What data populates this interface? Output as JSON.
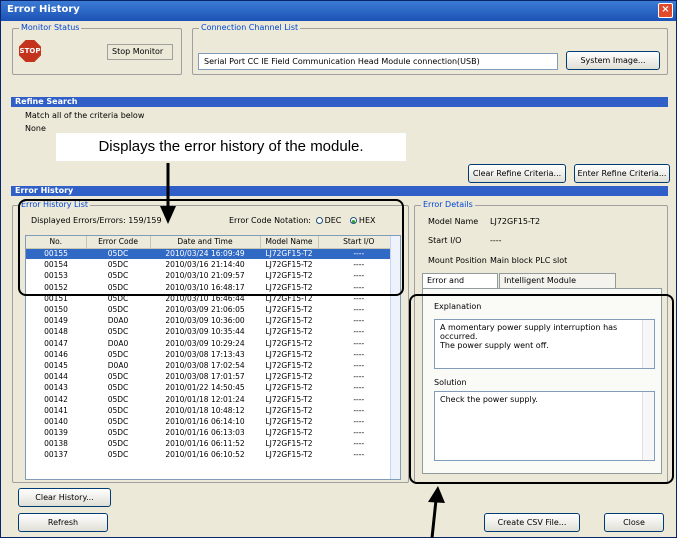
{
  "window": {
    "title": "Error History",
    "close": "×"
  },
  "monitor": {
    "group": "Monitor Status",
    "stop_icon": "STOP",
    "status": "Stop Monitor"
  },
  "connection": {
    "group": "Connection Channel List",
    "value": "Serial Port CC IE Field Communication Head Module connection(USB)",
    "system_image": "System Image..."
  },
  "refine": {
    "header": "Refine Search",
    "criteria": "Match all of the criteria below",
    "none": "None",
    "clear": "Clear Refine Criteria...",
    "enter": "Enter Refine Criteria..."
  },
  "callout": "Displays the error history of the module.",
  "history": {
    "header": "Error History",
    "list_group": "Error History List",
    "displayed": "Displayed Errors/Errors:  159/159",
    "notation_label": "Error Code Notation:",
    "dec": "DEC",
    "hex": "HEX",
    "columns": [
      "No.",
      "Error Code",
      "Date and Time",
      "Model Name",
      "Start I/O"
    ],
    "rows": [
      [
        "00155",
        "05DC",
        "2010/03/24 16:09:49",
        "LJ72GF15-T2",
        "----"
      ],
      [
        "00154",
        "05DC",
        "2010/03/16 21:14:40",
        "LJ72GF15-T2",
        "----"
      ],
      [
        "00153",
        "05DC",
        "2010/03/10 21:09:57",
        "LJ72GF15-T2",
        "----"
      ],
      [
        "00152",
        "05DC",
        "2010/03/10 16:48:17",
        "LJ72GF15-T2",
        "----"
      ],
      [
        "00151",
        "05DC",
        "2010/03/10 16:46:44",
        "LJ72GF15-T2",
        "----"
      ],
      [
        "00150",
        "05DC",
        "2010/03/09 21:06:05",
        "LJ72GF15-T2",
        "----"
      ],
      [
        "00149",
        "D0A0",
        "2010/03/09 10:36:00",
        "LJ72GF15-T2",
        "----"
      ],
      [
        "00148",
        "05DC",
        "2010/03/09 10:35:44",
        "LJ72GF15-T2",
        "----"
      ],
      [
        "00147",
        "D0A0",
        "2010/03/09 10:29:24",
        "LJ72GF15-T2",
        "----"
      ],
      [
        "00146",
        "05DC",
        "2010/03/08 17:13:43",
        "LJ72GF15-T2",
        "----"
      ],
      [
        "00145",
        "D0A0",
        "2010/03/08 17:02:54",
        "LJ72GF15-T2",
        "----"
      ],
      [
        "00144",
        "05DC",
        "2010/03/08 17:01:57",
        "LJ72GF15-T2",
        "----"
      ],
      [
        "00143",
        "05DC",
        "2010/01/22 14:50:45",
        "LJ72GF15-T2",
        "----"
      ],
      [
        "00142",
        "05DC",
        "2010/01/18 12:01:24",
        "LJ72GF15-T2",
        "----"
      ],
      [
        "00141",
        "05DC",
        "2010/01/18 10:48:12",
        "LJ72GF15-T2",
        "----"
      ],
      [
        "00140",
        "05DC",
        "2010/01/16 06:14:10",
        "LJ72GF15-T2",
        "----"
      ],
      [
        "00139",
        "05DC",
        "2010/01/16 06:13:03",
        "LJ72GF15-T2",
        "----"
      ],
      [
        "00138",
        "05DC",
        "2010/01/16 06:11:52",
        "LJ72GF15-T2",
        "----"
      ],
      [
        "00137",
        "05DC",
        "2010/01/16 06:10:52",
        "LJ72GF15-T2",
        "----"
      ]
    ],
    "clear_history": "Clear History..."
  },
  "details": {
    "group": "Error Details",
    "model_label": "Model Name",
    "model_value": "LJ72GF15-T2",
    "startio_label": "Start I/O",
    "startio_value": "----",
    "mount_label": "Mount Position",
    "mount_value": "Main block PLC slot",
    "tab1": "Error and Solution",
    "tab2": "Intelligent Module Information",
    "explanation_label": "Explanation",
    "explanation": "A momentary power supply interruption has occurred.\nThe power supply went off.",
    "solution_label": "Solution",
    "solution": "Check the power supply."
  },
  "footer": {
    "refresh": "Refresh",
    "csv": "Create CSV File...",
    "close": "Close"
  }
}
